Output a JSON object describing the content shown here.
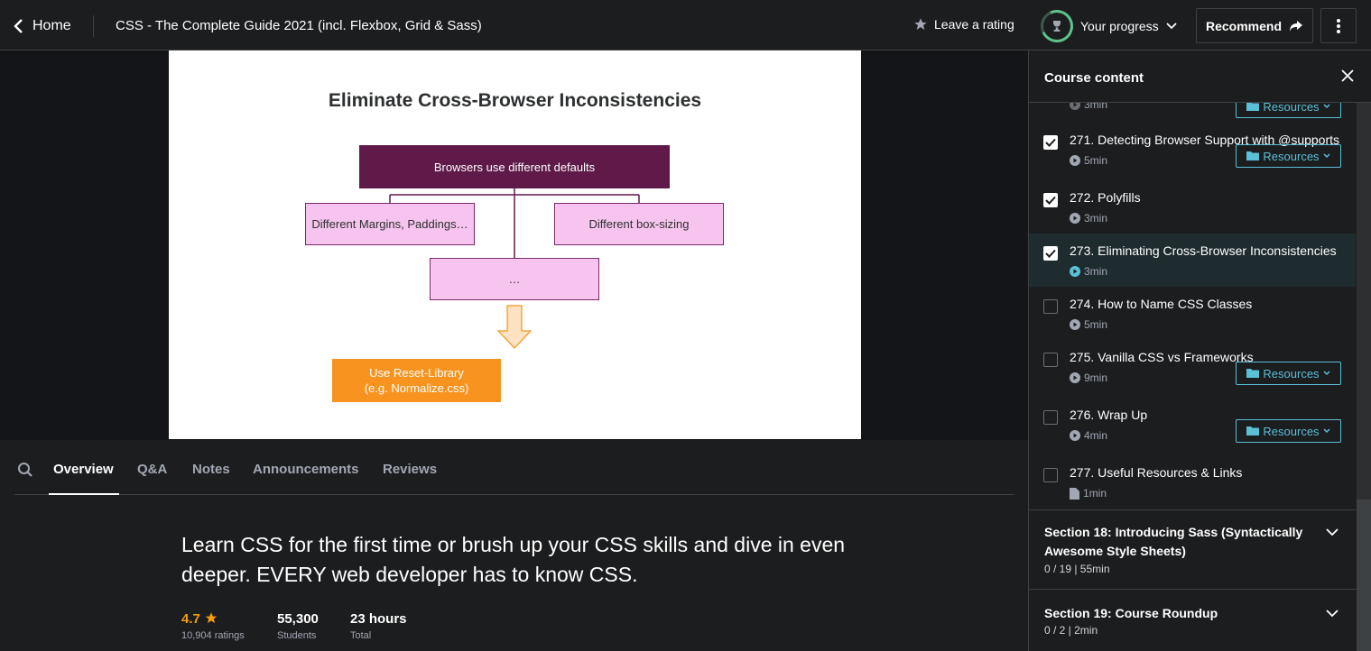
{
  "header": {
    "home_label": "Home",
    "course_title": "CSS - The Complete Guide 2021 (incl. Flexbox, Grid & Sass)",
    "rating_label": "Leave a rating",
    "progress_label": "Your progress",
    "recommend_label": "Recommend"
  },
  "slide": {
    "title": "Eliminate Cross-Browser Inconsistencies",
    "top_box": "Browsers use different defaults",
    "box_margins": "Different Margins, Paddings…",
    "box_sizing": "Different box-sizing",
    "box_more": "…",
    "box_solution_line1": "Use Reset-Library",
    "box_solution_line2": "(e.g. Normalize.css)"
  },
  "tabs": [
    "Overview",
    "Q&A",
    "Notes",
    "Announcements",
    "Reviews"
  ],
  "overview": {
    "headline": "Learn CSS for the first time or brush up your CSS skills and dive in even deeper. EVERY web developer has to know CSS.",
    "rating_value": "4.7",
    "rating_count": "10,904 ratings",
    "students_value": "55,300",
    "students_label": "Students",
    "hours_value": "23 hours",
    "hours_label": "Total"
  },
  "sidebar": {
    "title": "Course content",
    "partial_meta": "3min",
    "resources_label": "Resources",
    "lectures": [
      {
        "title": "271. Detecting Browser Support with @supports",
        "duration": "5min",
        "checked": true,
        "resources": true,
        "type": "video"
      },
      {
        "title": "272. Polyfills",
        "duration": "3min",
        "checked": true,
        "resources": false,
        "type": "video"
      },
      {
        "title": "273. Eliminating Cross-Browser Inconsistencies",
        "duration": "3min",
        "checked": true,
        "resources": false,
        "type": "video",
        "current": true
      },
      {
        "title": "274. How to Name CSS Classes",
        "duration": "5min",
        "checked": false,
        "resources": false,
        "type": "video"
      },
      {
        "title": "275. Vanilla CSS vs Frameworks",
        "duration": "9min",
        "checked": false,
        "resources": true,
        "type": "video"
      },
      {
        "title": "276. Wrap Up",
        "duration": "4min",
        "checked": false,
        "resources": true,
        "type": "video"
      },
      {
        "title": "277. Useful Resources & Links",
        "duration": "1min",
        "checked": false,
        "resources": false,
        "type": "article"
      }
    ],
    "sections": [
      {
        "title": "Section 18: Introducing Sass (Syntactically Awesome Style Sheets)",
        "meta": "0 / 19 | 55min"
      },
      {
        "title": "Section 19: Course Roundup",
        "meta": "0 / 2 | 2min"
      }
    ]
  },
  "colors": {
    "accent_teal": "#5bbfd6",
    "rating_orange": "#f69c08",
    "slide_purple": "#5f1a4a",
    "slide_pink": "#f6c4ee",
    "slide_orange": "#f7931e"
  }
}
